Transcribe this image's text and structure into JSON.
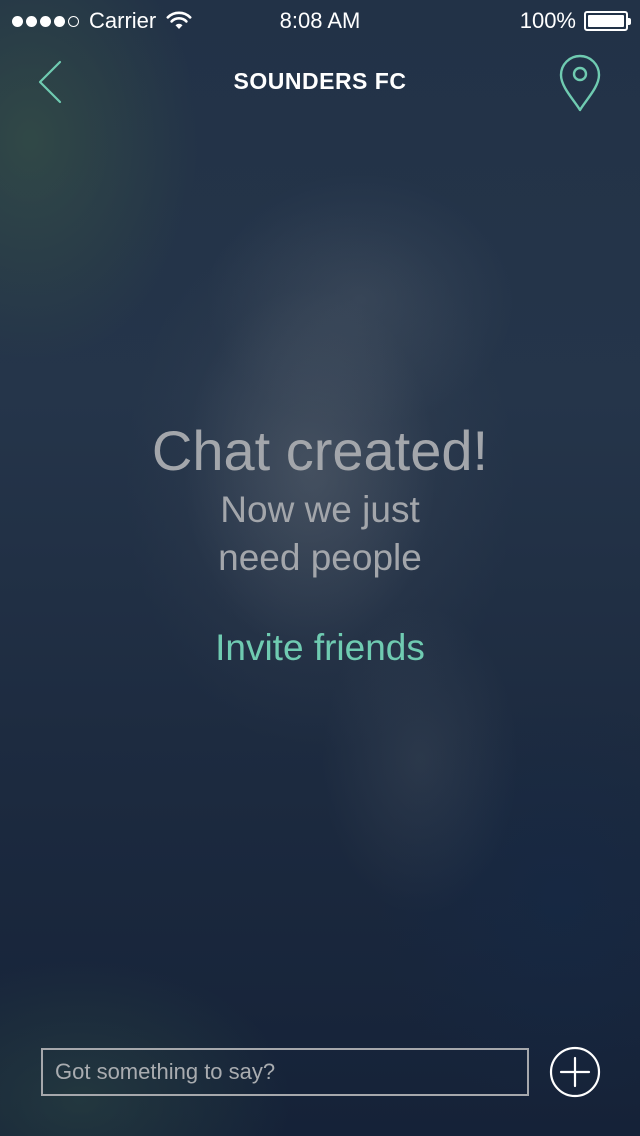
{
  "status_bar": {
    "signal_dots_filled": 4,
    "signal_dots_total": 5,
    "carrier": "Carrier",
    "time": "8:08 AM",
    "battery_percent": "100%",
    "battery_level": 1.0
  },
  "nav": {
    "title": "SOUNDERS FC",
    "back_icon": "chevron-left-icon",
    "location_icon": "map-pin-icon"
  },
  "empty_state": {
    "headline": "Chat created!",
    "subline_1": "Now we just",
    "subline_2": "need people",
    "invite_label": "Invite friends"
  },
  "composer": {
    "placeholder": "Got something to say?",
    "value": "",
    "add_icon": "plus-circle-icon"
  },
  "colors": {
    "accent": "#6fcbb1",
    "text_muted": "#a3a6ab",
    "white": "#ffffff"
  }
}
